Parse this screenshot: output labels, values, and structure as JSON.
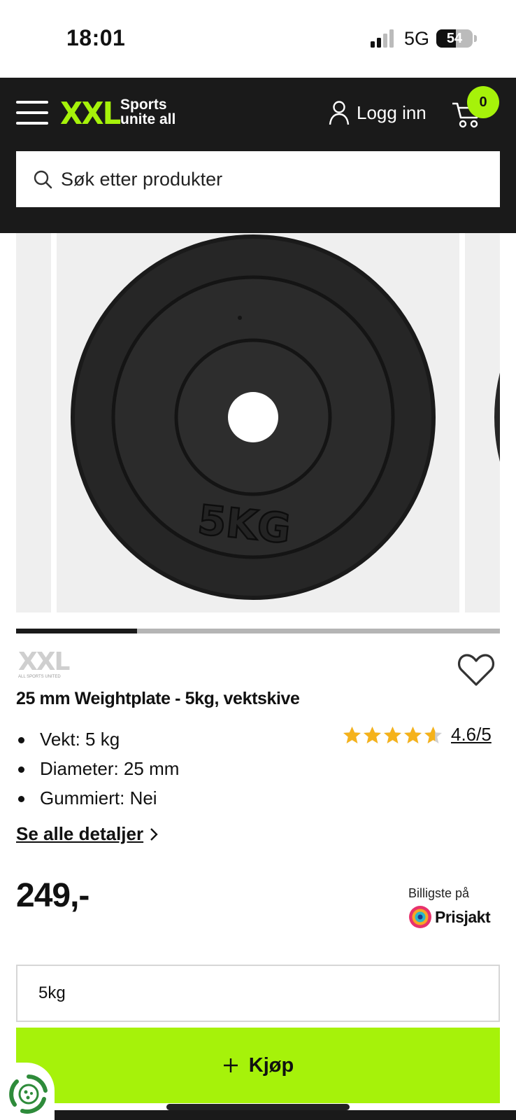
{
  "status_bar": {
    "time": "18:01",
    "network": "5G",
    "battery": "54",
    "battery_level": 0.54
  },
  "header": {
    "logo": "XXL",
    "tagline_line1": "Sports",
    "tagline_line2": "unite all",
    "login_label": "Logg inn",
    "cart_count": "0",
    "search_placeholder": "Søk etter produkter"
  },
  "gallery": {
    "progress": 0.25
  },
  "product": {
    "brand_logo": "XXL",
    "brand_logo_sub": "ALL SPORTS UNITED",
    "title": "25 mm Weightplate - 5kg, vektskive",
    "specs": [
      "Vekt: 5 kg",
      "Diameter: 25 mm",
      "Gummiert: Nei"
    ],
    "rating": "4.6/5",
    "rating_value": 4.6,
    "details_link": "Se alle detaljer",
    "price": "249,-",
    "prisjakt_label": "Billigste på",
    "prisjakt_name": "Prisjakt",
    "selected_variant": "5kg",
    "buy_label": "Kjøp"
  },
  "colors": {
    "accent": "#a6f20a",
    "header_bg": "#1a1a1a",
    "star": "#f5b21b"
  },
  "icons": [
    "hamburger-icon",
    "user-icon",
    "cart-icon",
    "search-icon",
    "heart-icon",
    "star-icon",
    "chevron-right-icon",
    "plus-icon",
    "eco-icon"
  ]
}
